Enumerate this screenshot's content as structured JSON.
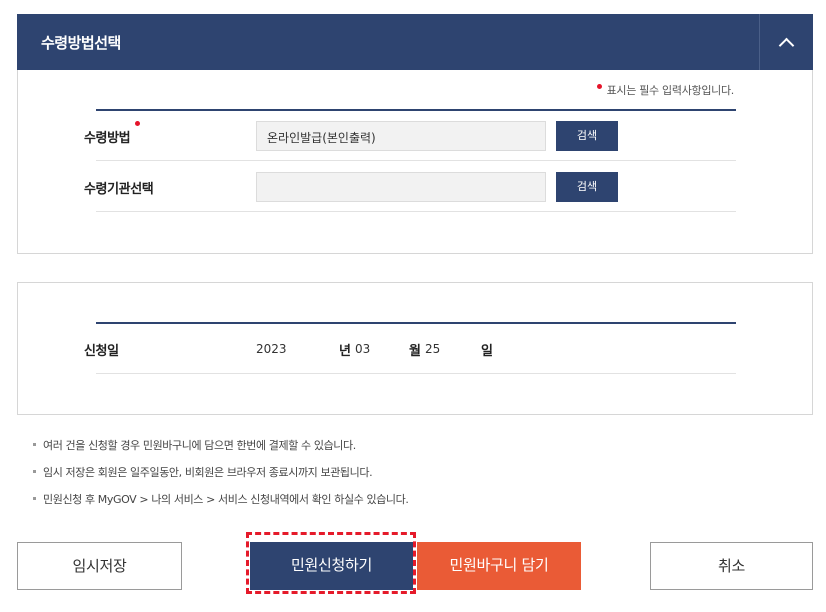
{
  "header": {
    "title": "수령방법선택"
  },
  "required_note": "표시는 필수 입력사항입니다.",
  "receipt": {
    "method_label": "수령방법",
    "method_value": "온라인발급(본인출력)",
    "agency_label": "수령기관선택",
    "agency_value": "",
    "search_label": "검색"
  },
  "apply_date": {
    "label": "신청일",
    "year": "2023",
    "year_unit": "년",
    "month": "03",
    "month_unit": "월",
    "day": "25",
    "day_unit": "일"
  },
  "notes": [
    "여러 건을 신청할 경우 민원바구니에 담으면 한번에 결제할 수 있습니다.",
    "임시 저장은 회원은 일주일동안, 비회원은 브라우저 종료시까지 보관됩니다.",
    "민원신청 후 MyGOV > 나의 서비스 > 서비스 신청내역에서 확인 하실수 있습니다."
  ],
  "buttons": {
    "save": "임시저장",
    "apply": "민원신청하기",
    "cart": "민원바구니 담기",
    "cancel": "취소"
  },
  "colors": {
    "primary": "#2e4470",
    "accent": "#ea5b36",
    "highlight": "#e51a2a"
  }
}
